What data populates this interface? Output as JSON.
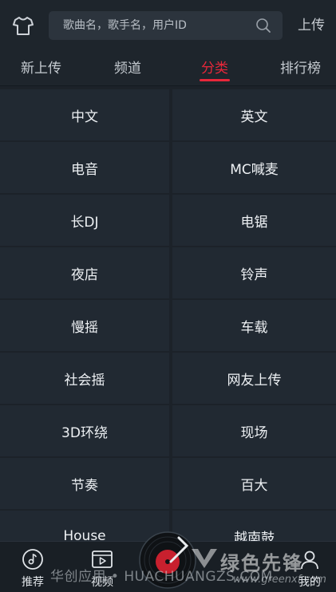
{
  "header": {
    "search_placeholder": "歌曲名，歌手名，用户ID",
    "upload_label": "上传"
  },
  "tabs": [
    {
      "label": "新上传"
    },
    {
      "label": "频道"
    },
    {
      "label": "分类"
    },
    {
      "label": "排行榜"
    }
  ],
  "active_tab": "分类",
  "categories": [
    "中文",
    "英文",
    "电音",
    "MC喊麦",
    "长DJ",
    "电锯",
    "夜店",
    "铃声",
    "慢摇",
    "车载",
    "社会摇",
    "网友上传",
    "3D环绕",
    "现场",
    "节奏",
    "百大",
    "House",
    "越南鼓"
  ],
  "bottom_nav": [
    {
      "label": "推荐",
      "icon": "music-disc-icon"
    },
    {
      "label": "视频",
      "icon": "video-play-icon"
    },
    {
      "label": "我的",
      "icon": "profile-icon"
    }
  ],
  "watermark": {
    "text": "华创应用 • HUACHUANGZS.COM",
    "brand": "绿色先锋",
    "url": "www.greenxf.com"
  },
  "colors": {
    "accent": "#e8273a",
    "background": "#1c2229",
    "cell": "#212932"
  }
}
